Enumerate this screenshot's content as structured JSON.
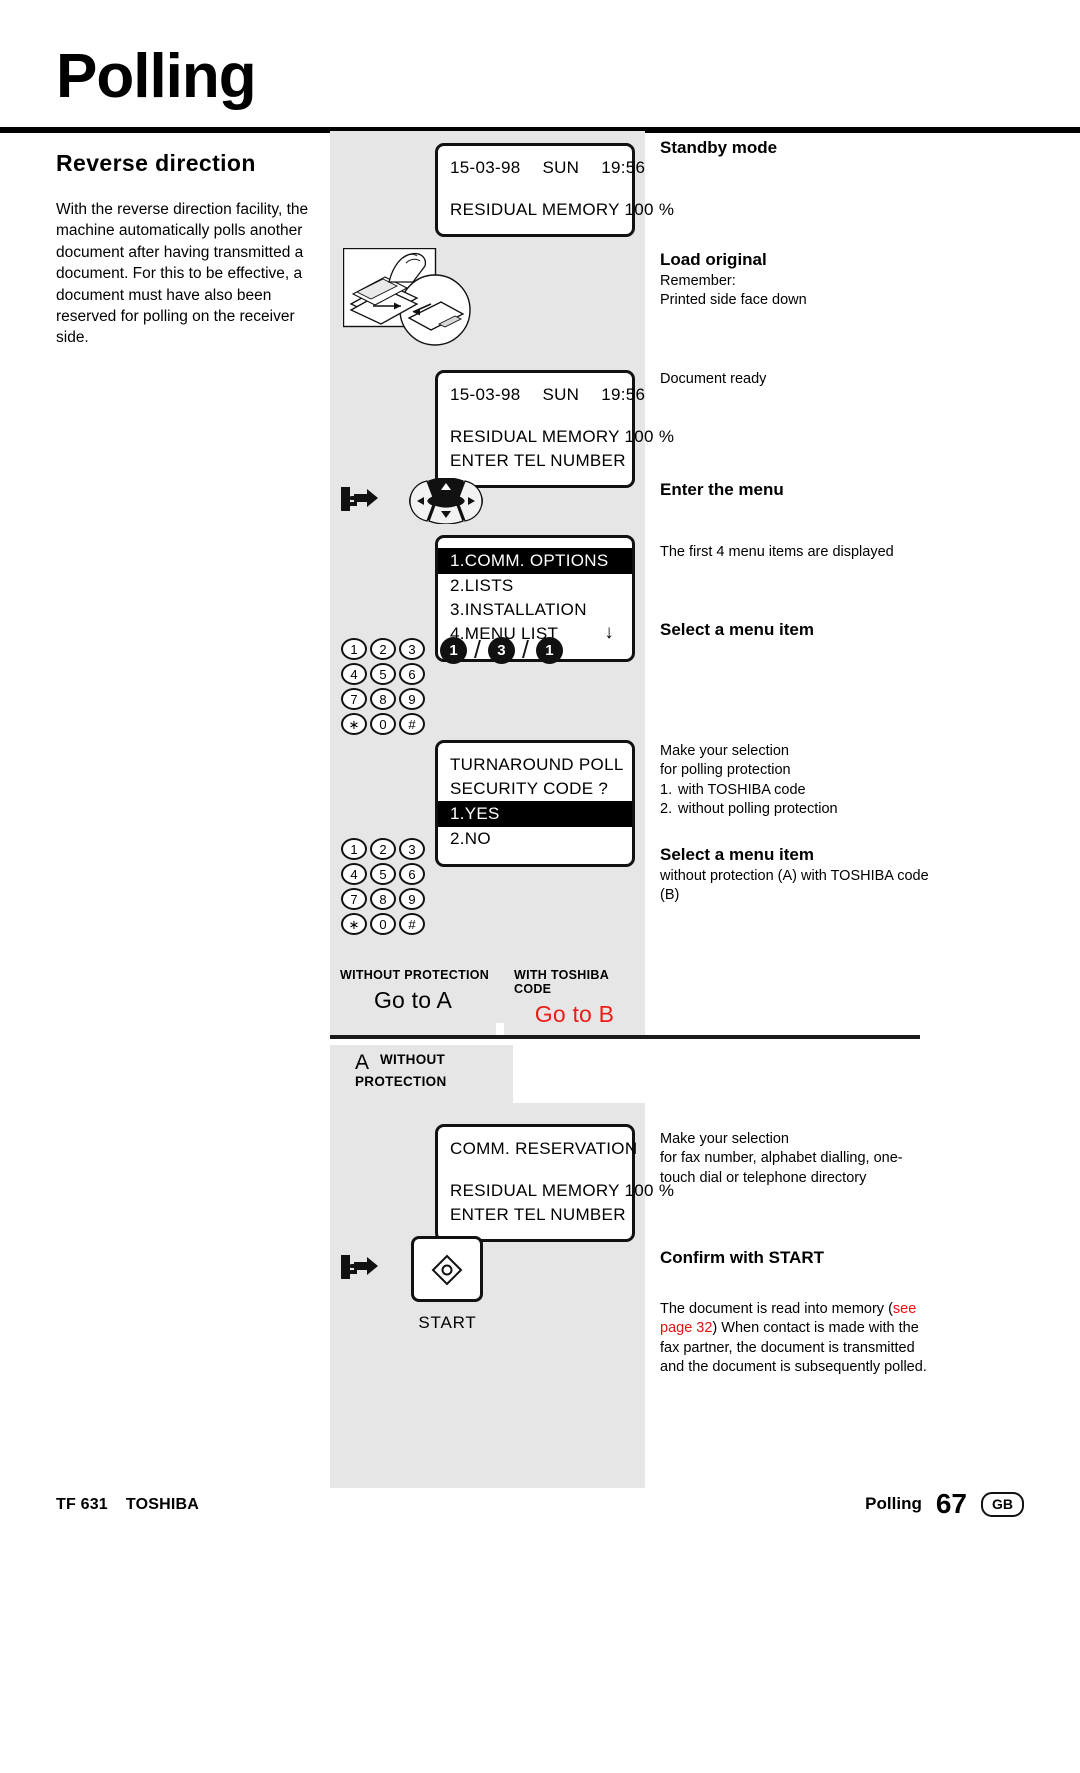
{
  "page": {
    "title": "Polling",
    "section_heading": "Reverse  direction",
    "intro": "With the reverse direction facility, the machine automatically polls another document after having transmitted a document. For this to be effective, a document must have also been reserved for polling on the receiver side."
  },
  "displays": {
    "standby": {
      "date": "15-03-98",
      "day": "SUN",
      "time": "19:56",
      "line2": "RESIDUAL MEMORY 100 %"
    },
    "ready": {
      "date": "15-03-98",
      "day": "SUN",
      "time": "19:56",
      "line2": "RESIDUAL MEMORY 100 %",
      "line3": "ENTER TEL NUMBER"
    },
    "menu": {
      "items": [
        "1.COMM. OPTIONS",
        "2.LISTS",
        "3.INSTALLATION",
        "4.MENU LIST"
      ],
      "selected_index": 0,
      "scroll_indicator": "↓"
    },
    "turnaround": {
      "line1": "TURNAROUND POLL",
      "line2": "SECURITY CODE ?",
      "options": [
        "1.YES",
        "2.NO"
      ],
      "selected_index": 0
    },
    "reservation": {
      "line1": "COMM. RESERVATION",
      "line2": "RESIDUAL MEMORY 100 %",
      "line3": "ENTER TEL NUMBER"
    }
  },
  "keypad": {
    "rows": [
      [
        "1",
        "2",
        "3"
      ],
      [
        "4",
        "5",
        "6"
      ],
      [
        "7",
        "8",
        "9"
      ],
      [
        "∗",
        "0",
        "#"
      ]
    ]
  },
  "key_sequence": {
    "keys": [
      "1",
      "3",
      "1"
    ],
    "separator": "/"
  },
  "annotations": {
    "standby": {
      "heading": "Standby mode"
    },
    "load": {
      "heading": "Load original",
      "line1": "Remember:",
      "line2": "Printed side face down"
    },
    "ready": {
      "heading": "Document ready"
    },
    "enter_menu": {
      "heading": "Enter the menu",
      "note": "The first 4 menu items are displayed"
    },
    "select_item_1": {
      "heading": "Select a menu item"
    },
    "selection": {
      "line1": "Make your selection",
      "line2": "for polling protection",
      "options": [
        {
          "num": "1.",
          "text": "with TOSHIBA code"
        },
        {
          "num": "2.",
          "text": "without polling protection"
        }
      ]
    },
    "select_item_2": {
      "heading": "Select a menu item",
      "text": "without protection (A) with TOSHIBA code (B)"
    },
    "reservation": {
      "line1": "Make your selection",
      "line2": "for fax number, alphabet dialling, one-touch dial or telephone directory"
    },
    "confirm": {
      "heading": "Confirm with START",
      "part1": "The document is read into memory (",
      "link1": "see page 32",
      "part2": ")",
      "rest": "When contact is made with the fax partner, the document is transmitted and the document is subsequently polled."
    }
  },
  "branches": {
    "a": {
      "caption": "WITHOUT  PROTECTION",
      "action": "Go to A"
    },
    "b": {
      "caption": "WITH TOSHIBA CODE",
      "action": "Go to B"
    }
  },
  "section_a": {
    "letter": "A",
    "line1": "WITHOUT",
    "line2": "PROTECTION"
  },
  "start_button": {
    "label": "START"
  },
  "footer": {
    "model": "TF 631",
    "brand": "TOSHIBA",
    "section": "Polling",
    "page_number": "67",
    "locale": "GB"
  },
  "colors": {
    "red": "#ee1c16",
    "panel_grey": "#e6e6e6",
    "ink": "#000000"
  }
}
